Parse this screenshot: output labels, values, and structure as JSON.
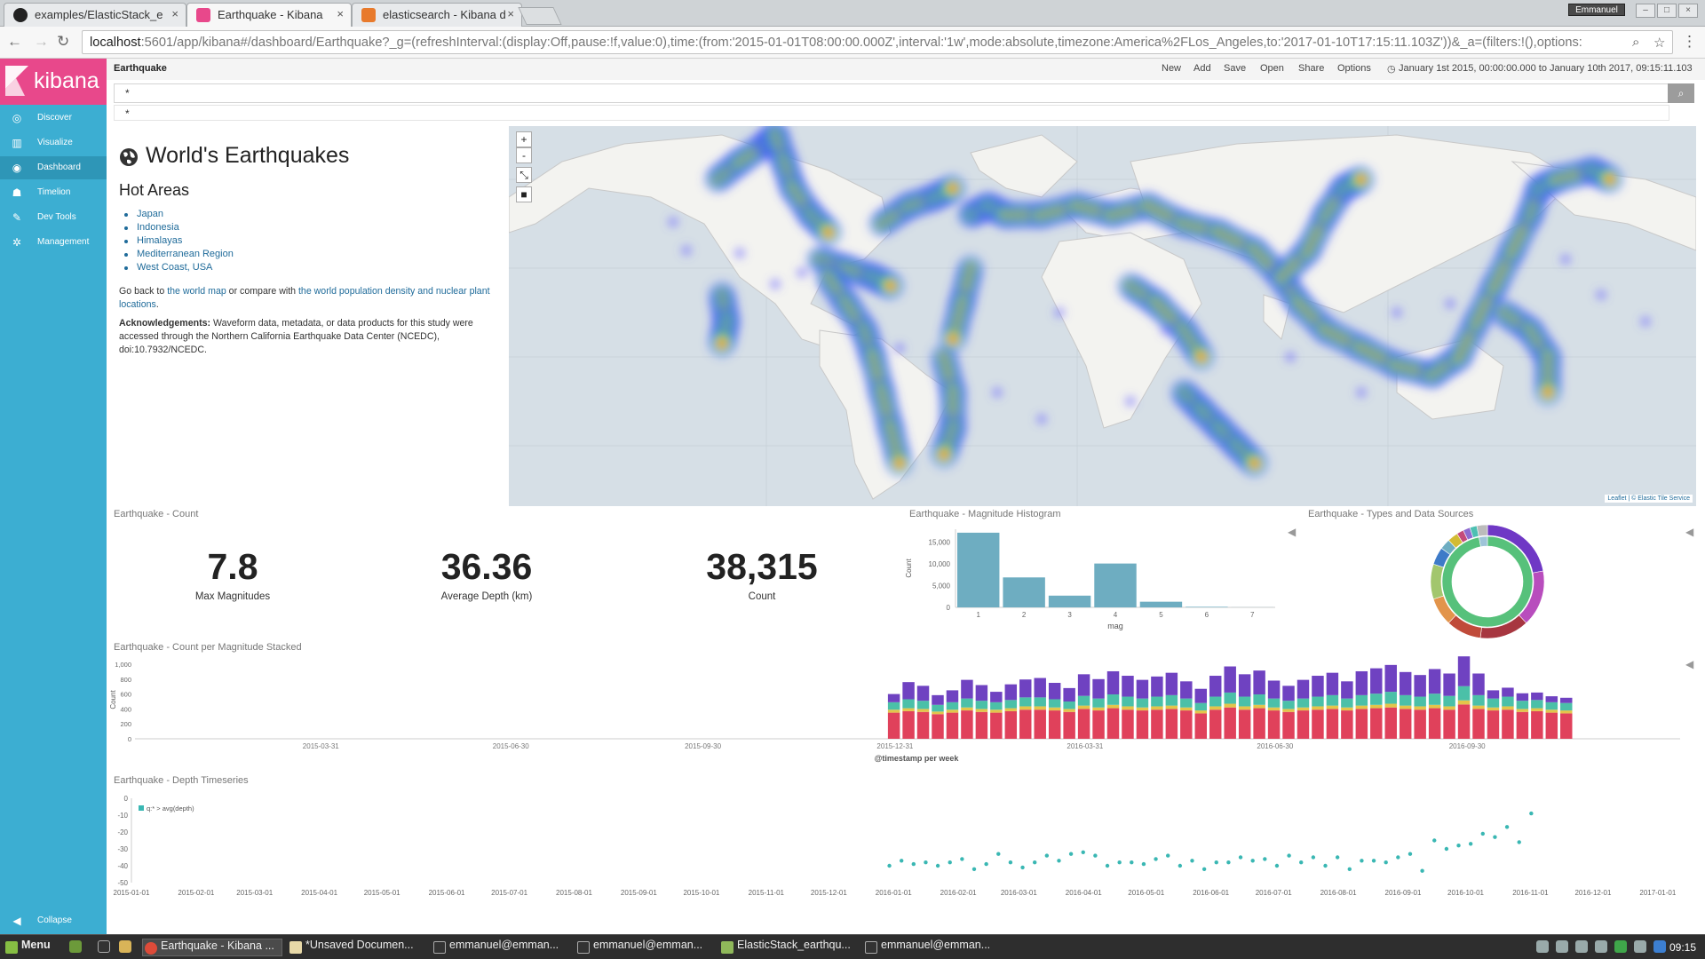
{
  "browser": {
    "tabs": [
      {
        "label": "examples/ElasticStack_e"
      },
      {
        "label": "Earthquake - Kibana"
      },
      {
        "label": "elasticsearch - Kibana d"
      }
    ],
    "user": "Emmanuel",
    "url_host": "localhost",
    "url_rest": ":5601/app/kibana#/dashboard/Earthquake?_g=(refreshInterval:(display:Off,pause:!f,value:0),time:(from:'2015-01-01T08:00:00.000Z',interval:'1w',mode:absolute,timezone:America%2FLos_Angeles,to:'2017-01-10T17:15:11.103Z'))&_a=(filters:!(),options:"
  },
  "sidebar": {
    "brand": "kibana",
    "items": [
      {
        "label": "Discover",
        "icon": "compass-icon"
      },
      {
        "label": "Visualize",
        "icon": "bar-chart-icon"
      },
      {
        "label": "Dashboard",
        "icon": "dashboard-icon",
        "active": true
      },
      {
        "label": "Timelion",
        "icon": "timelion-icon"
      },
      {
        "label": "Dev Tools",
        "icon": "wrench-icon"
      },
      {
        "label": "Management",
        "icon": "gear-icon"
      }
    ],
    "collapse": "Collapse"
  },
  "topnav": {
    "title": "Earthquake",
    "actions": [
      "New",
      "Add",
      "Save",
      "Open",
      "Share",
      "Options"
    ],
    "time_range": "January 1st 2015, 00:00:00.000 to January 10th 2017, 09:15:11.103"
  },
  "query": {
    "value": "*",
    "suggestion": "*"
  },
  "markdown": {
    "title": "World's Earthquakes",
    "hot_areas_title": "Hot Areas",
    "hot_areas": [
      "Japan",
      "Indonesia",
      "Himalayas",
      "Mediterranean Region",
      "West Coast, USA"
    ],
    "p1_pre": "Go back to ",
    "p1_link1": "the world map",
    "p1_mid": " or compare with ",
    "p1_link2": "the world population density and nuclear plant locations",
    "p1_post": ".",
    "ack_label": "Acknowledgements:",
    "ack_text": " Waveform data, metadata, or data products for this study were accessed through the Northern California Earthquake Data Center (NCEDC), doi:10.7932/NCEDC."
  },
  "map": {
    "zoom_in": "+",
    "zoom_out": "-",
    "attribution_link": "Leaflet",
    "attribution_sep": " | © ",
    "attribution_service": "Elastic Tile Service"
  },
  "count_panel": {
    "title": "Earthquake - Count",
    "metrics": [
      {
        "value": "7.8",
        "label": "Max Magnitudes"
      },
      {
        "value": "36.36",
        "label": "Average Depth (km)"
      },
      {
        "value": "38,315",
        "label": "Count"
      }
    ]
  },
  "histogram_title": "Earthquake - Magnitude Histogram",
  "donut_title": "Earthquake - Types and Data Sources",
  "stacked_title": "Earthquake - Count per Magnitude Stacked",
  "depth_title": "Earthquake - Depth Timeseries",
  "chart_data": [
    {
      "type": "bar",
      "title": "Earthquake - Magnitude Histogram",
      "xlabel": "mag",
      "ylabel": "Count",
      "categories": [
        "1",
        "2",
        "3",
        "4",
        "5",
        "6",
        "7"
      ],
      "values": [
        17200,
        6900,
        2700,
        10100,
        1300,
        130,
        20
      ],
      "yticks": [
        "15,000",
        "10,000",
        "5,000",
        "0"
      ],
      "ylim": [
        0,
        18000
      ],
      "color": "#6eadc1"
    },
    {
      "type": "pie",
      "title": "Earthquake - Types and Data Sources",
      "inner": [
        {
          "value": 97,
          "color": "#57c17b"
        },
        {
          "value": 3,
          "color": "#9ec4d8"
        }
      ],
      "outer": [
        {
          "value": 22,
          "color": "#6f38c5"
        },
        {
          "value": 16,
          "color": "#b84dbd"
        },
        {
          "value": 14,
          "color": "#a73640"
        },
        {
          "value": 10,
          "color": "#c04b3a"
        },
        {
          "value": 8,
          "color": "#e2944b"
        },
        {
          "value": 10,
          "color": "#a2c66d"
        },
        {
          "value": 5,
          "color": "#3e7bc8"
        },
        {
          "value": 3,
          "color": "#6eadc1"
        },
        {
          "value": 3,
          "color": "#d3bb33"
        },
        {
          "value": 2,
          "color": "#c44a7b"
        },
        {
          "value": 2,
          "color": "#8e6bd1"
        },
        {
          "value": 2,
          "color": "#4dc0b2"
        },
        {
          "value": 3,
          "color": "#bbbbbb"
        }
      ]
    },
    {
      "type": "bar",
      "stacked": true,
      "title": "Earthquake - Count per Magnitude Stacked",
      "xlabel": "@timestamp per week",
      "ylabel": "Count",
      "ylim": [
        0,
        1000
      ],
      "yticks": [
        "1,000",
        "800",
        "600",
        "400",
        "200",
        "0"
      ],
      "xticks": [
        "2015-03-31",
        "2015-06-30",
        "2015-09-30",
        "2015-12-31",
        "2016-03-31",
        "2016-06-30",
        "2016-09-30"
      ],
      "segment_colors": [
        "#e0415b",
        "#e3c54a",
        "#4bc0a8",
        "#6f42c1"
      ],
      "series": [
        {
          "name": "1",
          "values": [
            350,
            370,
            360,
            330,
            350,
            380,
            360,
            350,
            370,
            390,
            390,
            380,
            360,
            400,
            380,
            410,
            390,
            380,
            390,
            400,
            380,
            340,
            390,
            420,
            390,
            410,
            380,
            360,
            380,
            390,
            400,
            380,
            400,
            410,
            420,
            400,
            390,
            410,
            390,
            460,
            400,
            380,
            390,
            360,
            370,
            350,
            340
          ]
        },
        {
          "name": "2",
          "values": [
            40,
            40,
            40,
            35,
            40,
            40,
            40,
            40,
            40,
            45,
            45,
            40,
            40,
            45,
            40,
            45,
            45,
            40,
            45,
            45,
            40,
            40,
            45,
            50,
            45,
            45,
            40,
            40,
            40,
            45,
            45,
            40,
            45,
            45,
            50,
            45,
            45,
            45,
            45,
            55,
            45,
            40,
            45,
            40,
            40,
            40,
            40
          ]
        },
        {
          "name": "3",
          "values": [
            100,
            120,
            110,
            90,
            100,
            120,
            110,
            100,
            110,
            120,
            120,
            110,
            100,
            130,
            120,
            140,
            130,
            120,
            130,
            140,
            120,
            100,
            130,
            150,
            130,
            140,
            120,
            110,
            120,
            130,
            140,
            120,
            140,
            150,
            160,
            140,
            130,
            150,
            140,
            190,
            140,
            120,
            130,
            110,
            110,
            100,
            100
          ]
        },
        {
          "name": "4",
          "values": [
            110,
            230,
            200,
            130,
            160,
            250,
            210,
            140,
            210,
            240,
            260,
            220,
            180,
            290,
            260,
            310,
            280,
            250,
            270,
            300,
            230,
            190,
            280,
            350,
            300,
            320,
            240,
            200,
            250,
            280,
            300,
            230,
            320,
            340,
            360,
            310,
            290,
            330,
            300,
            400,
            290,
            110,
            120,
            100,
            100,
            80,
            70
          ]
        }
      ]
    },
    {
      "type": "scatter",
      "title": "Earthquake - Depth Timeseries",
      "legend": "q:* > avg(depth)",
      "ylim": [
        -50,
        0
      ],
      "yticks": [
        "0",
        "-10",
        "-20",
        "-30",
        "-40",
        "-50"
      ],
      "xticks": [
        "2015-01-01",
        "2015-02-01",
        "2015-03-01",
        "2015-04-01",
        "2015-05-01",
        "2015-06-01",
        "2015-07-01",
        "2015-08-01",
        "2015-09-01",
        "2015-10-01",
        "2015-11-01",
        "2015-12-01",
        "2016-01-01",
        "2016-02-01",
        "2016-03-01",
        "2016-04-01",
        "2016-05-01",
        "2016-06-01",
        "2016-07-01",
        "2016-08-01",
        "2016-09-01",
        "2016-10-01",
        "2016-11-01",
        "2016-12-01",
        "2017-01-01"
      ],
      "color": "#3ab7b3",
      "x_days": [
        363,
        370,
        377,
        384,
        391,
        398,
        405,
        412,
        419,
        426,
        433,
        440,
        447,
        454,
        461,
        468,
        475,
        482,
        489,
        496,
        503,
        510,
        517,
        524,
        531,
        538,
        545,
        552,
        559,
        566,
        573,
        580,
        587,
        594,
        601,
        608,
        615,
        622,
        629,
        636,
        643,
        650,
        657,
        664,
        671,
        678
      ],
      "y": [
        -40,
        -37,
        -39,
        -38,
        -40,
        -38,
        -36,
        -42,
        -39,
        -33,
        -38,
        -41,
        -38,
        -34,
        -37,
        -33,
        -32,
        -34,
        -40,
        -38,
        -38,
        -39,
        -36,
        -34,
        -40,
        -37,
        -42,
        -38,
        -38,
        -35,
        -37,
        -36,
        -40,
        -34,
        -38,
        -35,
        -40,
        -35,
        -42,
        -37,
        -37,
        -38,
        -35,
        -33,
        -43,
        -25,
        -30,
        -28,
        -27,
        -21,
        -23,
        -17,
        -26,
        -9
      ]
    }
  ],
  "taskbar": {
    "menu": "Menu",
    "items": [
      "Earthquake - Kibana ...",
      "*Unsaved Documen...",
      "emmanuel@emman...",
      "emmanuel@emman...",
      "ElasticStack_earthqu...",
      "emmanuel@emman..."
    ],
    "clock": "09:15"
  }
}
